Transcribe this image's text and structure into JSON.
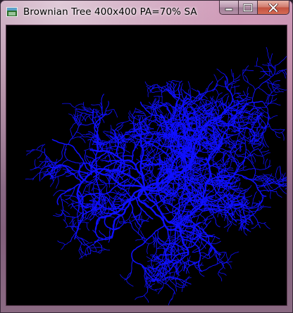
{
  "window": {
    "title": "Brownian Tree 400x400 PA=70% SA...",
    "icon": "app-window-icon",
    "controls": {
      "minimize": "minimize-icon",
      "maximize": "maximize-icon",
      "close": "close-icon"
    }
  },
  "canvas": {
    "background": "#000000",
    "particle_color": "#1010ff"
  }
}
